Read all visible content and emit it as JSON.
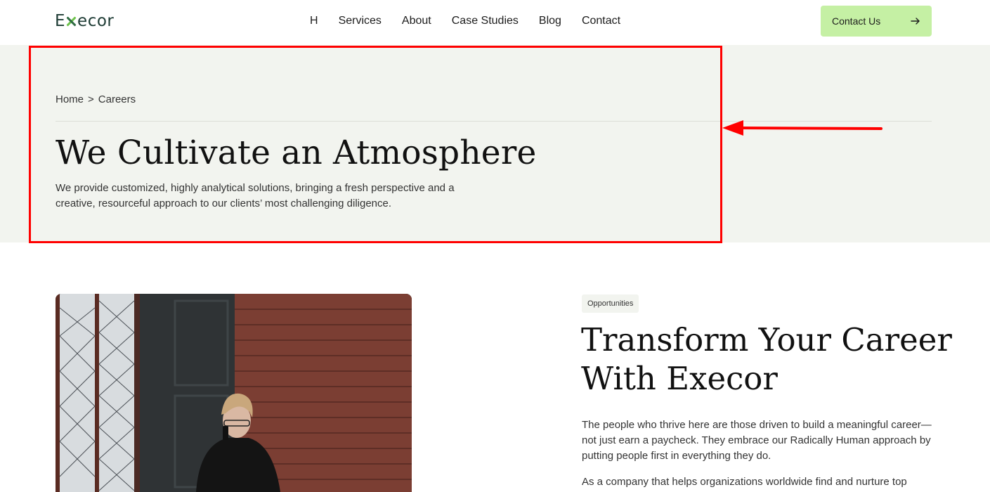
{
  "header": {
    "logo_start": "E",
    "logo_end": "ecor",
    "nav": [
      "H",
      "Services",
      "About",
      "Case Studies",
      "Blog",
      "Contact"
    ],
    "cta_label": "Contact Us"
  },
  "hero": {
    "breadcrumb": {
      "home": "Home",
      "separator": ">",
      "current": "Careers"
    },
    "title": "We Cultivate an Atmosphere",
    "description": "We provide customized, highly analytical solutions, bringing a fresh perspective and a creative, resourceful approach to our clients’ most challenging diligence."
  },
  "section": {
    "tag": "Opportunities",
    "title_line1": "Transform Your Career",
    "title_line2": "With Execor",
    "paragraph1": "The people who thrive here are those driven to build a meaningful career—not just earn a paycheck. They embrace our Radically Human approach by putting people first in everything they do.",
    "paragraph2": "As a company that helps organizations worldwide find and nurture top"
  },
  "colors": {
    "hero_bg": "#f2f4ef",
    "cta_bg": "#c5f0a4",
    "logo_green": "#6cc24a",
    "annotation_red": "#ff0000"
  }
}
